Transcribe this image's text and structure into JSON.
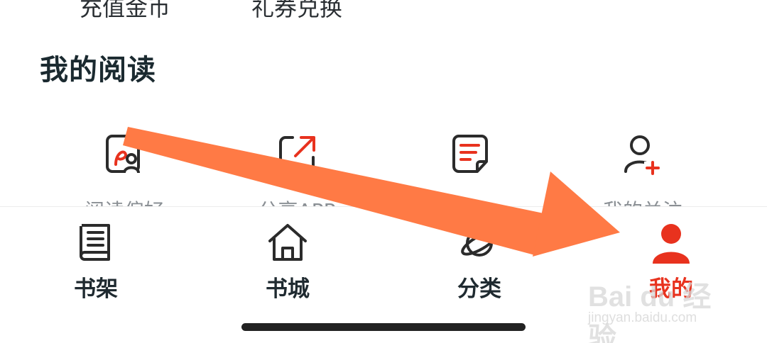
{
  "top_row": {
    "left_label": "充值金币",
    "right_label": "礼券兑换"
  },
  "section": {
    "title": "我的阅读"
  },
  "reading_items": [
    {
      "label": "阅读偏好",
      "icon": "reading-preference-icon"
    },
    {
      "label": "分享APP",
      "icon": "share-app-icon"
    },
    {
      "label": "",
      "icon": "note-icon"
    },
    {
      "label": "我的关注",
      "icon": "add-follow-icon"
    }
  ],
  "tabbar": {
    "tabs": [
      {
        "label": "书架",
        "icon": "bookshelf-icon",
        "active": false
      },
      {
        "label": "书城",
        "icon": "home-icon",
        "active": false
      },
      {
        "label": "分类",
        "icon": "planet-icon",
        "active": false
      },
      {
        "label": "我的",
        "icon": "profile-icon",
        "active": true
      }
    ]
  },
  "watermark": {
    "text": "Bai du 经验",
    "url": "jingyan.baidu.com"
  },
  "colors": {
    "accent": "#e8321e",
    "arrow": "#ff7a45",
    "text": "#1f2a30",
    "muted": "#8a8f94"
  }
}
